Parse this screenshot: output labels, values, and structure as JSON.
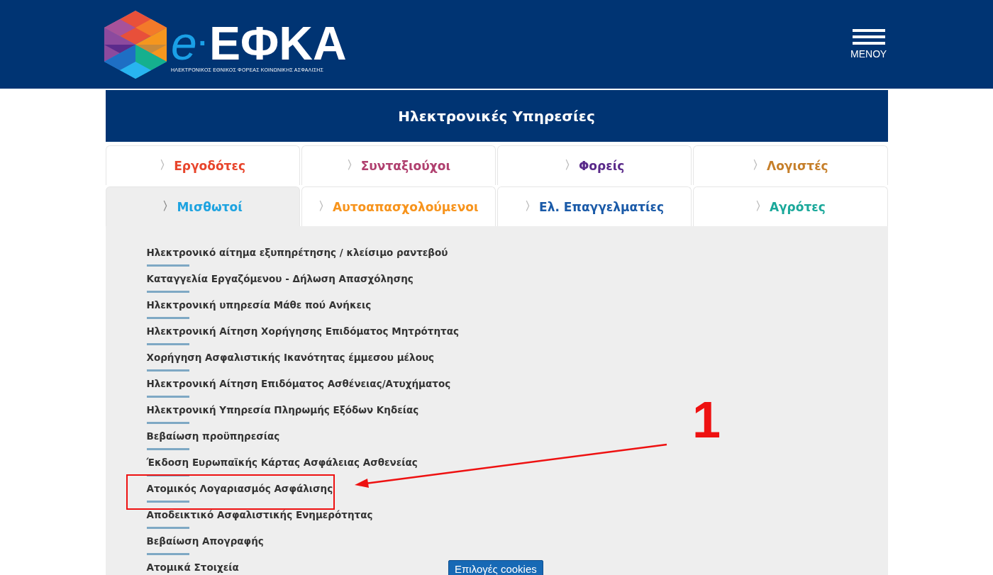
{
  "header": {
    "logo": {
      "prefix": "e",
      "dot": "·",
      "name": "ΕΦΚΑ",
      "tagline": "ΗΛΕΚΤΡΟΝΙΚΟΣ ΕΘΝΙΚΟΣ ΦΟΡΕΑΣ ΚΟΙΝΩΝΙΚΗΣ ΑΣΦΑΛΙΣΗΣ"
    },
    "menu_label": "ΜΕΝΟΥ"
  },
  "title": "Ηλεκτρονικές Υπηρεσίες",
  "chevron": "〉",
  "tabs": [
    {
      "label": "Εργοδότες",
      "color": "#e8452c",
      "selected": false
    },
    {
      "label": "Συνταξιούχοι",
      "color": "#b0406f",
      "selected": false
    },
    {
      "label": "Φορείς",
      "color": "#5a2a8a",
      "selected": false
    },
    {
      "label": "Λογιστές",
      "color": "#c67f2a",
      "selected": false
    },
    {
      "label": "Μισθωτοί",
      "color": "#1ea3e0",
      "selected": true
    },
    {
      "label": "Αυτοαπασχολούμενοι",
      "color": "#f7941d",
      "selected": false
    },
    {
      "label": "Ελ. Επαγγελματίες",
      "color": "#1a5aa8",
      "selected": false
    },
    {
      "label": "Αγρότες",
      "color": "#1aa89a",
      "selected": false
    }
  ],
  "services": [
    {
      "label": "Ηλεκτρονικό αίτημα εξυπηρέτησης / κλείσιμο ραντεβού",
      "highlighted": false
    },
    {
      "label": "Καταγγελία Εργαζόμενου - Δήλωση Απασχόλησης",
      "highlighted": false
    },
    {
      "label": "Ηλεκτρονική υπηρεσία Μάθε πού Ανήκεις",
      "highlighted": false
    },
    {
      "label": "Ηλεκτρονική Αίτηση Χορήγησης Επιδόματος Μητρότητας",
      "highlighted": false
    },
    {
      "label": "Χορήγηση Ασφαλιστικής Ικανότητας έμμεσου μέλους",
      "highlighted": false
    },
    {
      "label": "Ηλεκτρονική Αίτηση Επιδόματος Ασθένειας/Ατυχήματος",
      "highlighted": false
    },
    {
      "label": "Ηλεκτρονική Υπηρεσία Πληρωμής Εξόδων Κηδείας",
      "highlighted": false
    },
    {
      "label": "Βεβαίωση προϋπηρεσίας",
      "highlighted": false
    },
    {
      "label": "Έκδοση Ευρωπαϊκής Κάρτας Ασφάλειας Ασθενείας",
      "highlighted": false
    },
    {
      "label": "Ατομικός Λογαριασμός Ασφάλισης",
      "highlighted": true
    },
    {
      "label": "Αποδεικτικό Ασφαλιστικής Ενημερότητας",
      "highlighted": false
    },
    {
      "label": "Βεβαίωση Απογραφής",
      "highlighted": false
    },
    {
      "label": "Ατομικά Στοιχεία",
      "highlighted": false
    }
  ],
  "annotation": {
    "number": "1"
  },
  "cookies_button": "Επιλογές cookies"
}
